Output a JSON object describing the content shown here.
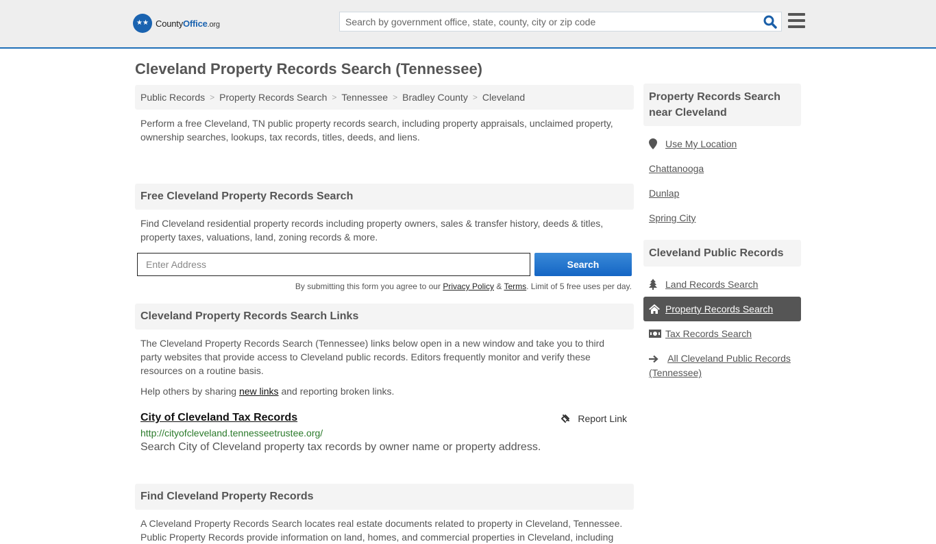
{
  "header": {
    "logo": {
      "brand_plain": "County",
      "brand_bold": "Office",
      "brand_suffix": ".org"
    },
    "search_placeholder": "Search by government office, state, county, city or zip code",
    "search_icon": "magnifier-icon",
    "menu_icon": "hamburger-icon"
  },
  "page": {
    "title": "Cleveland Property Records Search (Tennessee)"
  },
  "breadcrumb": [
    {
      "label": "Public Records"
    },
    {
      "label": "Property Records Search"
    },
    {
      "label": "Tennessee"
    },
    {
      "label": "Bradley County"
    },
    {
      "label": "Cleveland"
    }
  ],
  "intro": "Perform a free Cleveland, TN public property records search, including property appraisals, unclaimed property, ownership searches, lookups, tax records, titles, deeds, and liens.",
  "free_search": {
    "heading": "Free Cleveland Property Records Search",
    "text": "Find Cleveland residential property records including property owners, sales & transfer history, deeds & titles, property taxes, valuations, land, zoning records & more.",
    "address_placeholder": "Enter Address",
    "button": "Search",
    "disclaimer_pre": "By submitting this form you agree to our ",
    "privacy": "Privacy Policy",
    "amp": " & ",
    "terms": "Terms",
    "disclaimer_post": ". Limit of 5 free uses per day."
  },
  "links_section": {
    "heading": "Cleveland Property Records Search Links",
    "text": "The Cleveland Property Records Search (Tennessee) links below open in a new window and take you to third party websites that provide access to Cleveland public records. Editors frequently monitor and verify these resources on a routine basis.",
    "help_pre": "Help others by sharing ",
    "help_link": "new links",
    "help_post": " and reporting broken links.",
    "entries": [
      {
        "title": "City of Cleveland Tax Records",
        "report": "Report Link",
        "url": "http://cityofcleveland.tennesseetrustee.org/",
        "description": "Search City of Cleveland property tax records by owner name or property address."
      }
    ]
  },
  "find_section": {
    "heading": "Find Cleveland Property Records",
    "text": "A Cleveland Property Records Search locates real estate documents related to property in Cleveland, Tennessee. Public Property Records provide information on land, homes, and commercial properties in Cleveland, including"
  },
  "sidebar": {
    "nearby_heading": "Property Records Search near Cleveland",
    "nearby": [
      {
        "label": "Use My Location",
        "icon": "map-marker-icon"
      },
      {
        "label": "Chattanooga"
      },
      {
        "label": "Dunlap"
      },
      {
        "label": "Spring City"
      }
    ],
    "public_heading": "Cleveland Public Records",
    "public": [
      {
        "label": "Land Records Search",
        "icon": "tree-icon",
        "active": false
      },
      {
        "label": "Property Records Search",
        "icon": "home-icon",
        "active": true
      },
      {
        "label": "Tax Records Search",
        "icon": "money-icon",
        "active": false
      },
      {
        "label": "All Cleveland Public Records (Tennessee)",
        "icon": "arrow-right-icon",
        "active": false
      }
    ]
  },
  "colors": {
    "brand": "#1a63b0",
    "active_bg": "#555555",
    "url_green": "#2a7a2a"
  }
}
